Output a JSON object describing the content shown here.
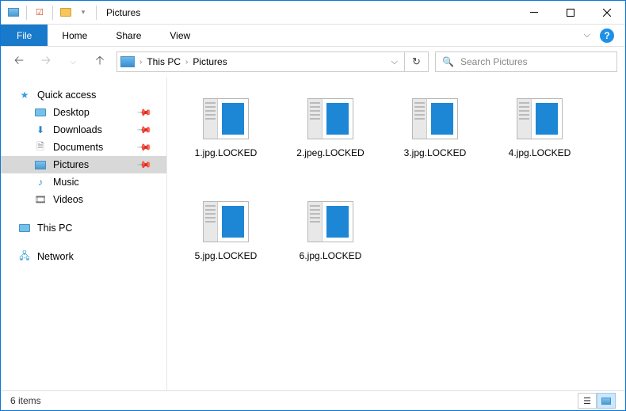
{
  "titlebar": {
    "title": "Pictures"
  },
  "ribbon": {
    "file": "File",
    "tabs": [
      "Home",
      "Share",
      "View"
    ]
  },
  "breadcrumb": {
    "parts": [
      "This PC",
      "Pictures"
    ]
  },
  "search": {
    "placeholder": "Search Pictures"
  },
  "sidebar": {
    "quick_access": {
      "label": "Quick access"
    },
    "items": [
      {
        "label": "Desktop",
        "icon": "desktop",
        "pinned": true
      },
      {
        "label": "Downloads",
        "icon": "downloads",
        "pinned": true
      },
      {
        "label": "Documents",
        "icon": "documents",
        "pinned": true
      },
      {
        "label": "Pictures",
        "icon": "pictures",
        "pinned": true,
        "selected": true
      },
      {
        "label": "Music",
        "icon": "music",
        "pinned": false
      },
      {
        "label": "Videos",
        "icon": "videos",
        "pinned": false
      }
    ],
    "this_pc": {
      "label": "This PC"
    },
    "network": {
      "label": "Network"
    }
  },
  "files": [
    {
      "name": "1.jpg.LOCKED"
    },
    {
      "name": "2.jpeg.LOCKED"
    },
    {
      "name": "3.jpg.LOCKED"
    },
    {
      "name": "4.jpg.LOCKED"
    },
    {
      "name": "5.jpg.LOCKED"
    },
    {
      "name": "6.jpg.LOCKED"
    }
  ],
  "statusbar": {
    "count": "6 items"
  }
}
